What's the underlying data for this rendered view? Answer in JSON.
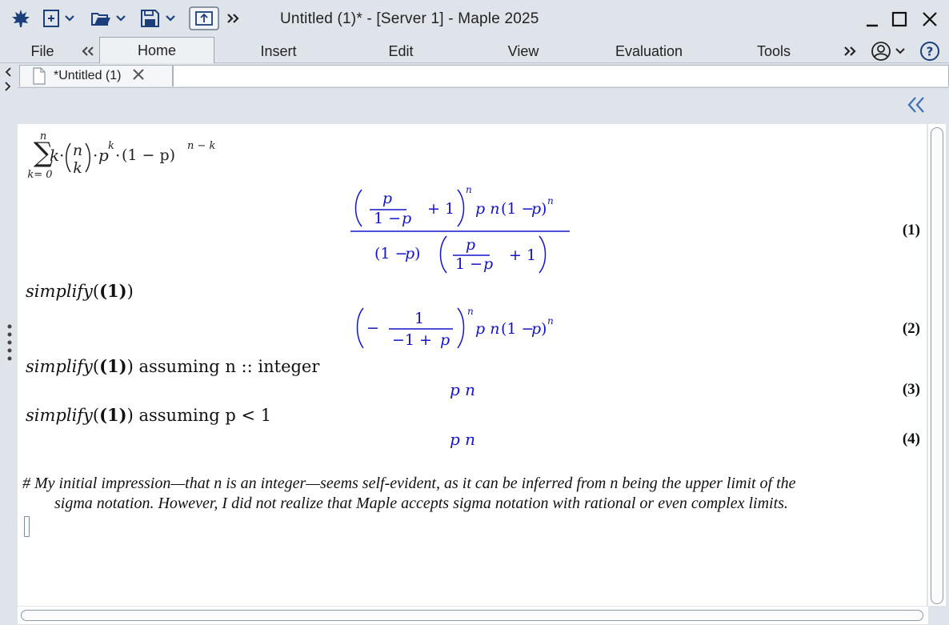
{
  "window": {
    "title": "Untitled (1)* - [Server 1] - Maple 2025"
  },
  "ribbon": {
    "tabs": [
      {
        "label": "File"
      },
      {
        "label": "Home"
      },
      {
        "label": "Insert"
      },
      {
        "label": "Edit"
      },
      {
        "label": "View"
      },
      {
        "label": "Evaluation"
      },
      {
        "label": "Tools"
      }
    ],
    "active_tab": "Home"
  },
  "document_tab": {
    "label": "*Untitled (1)"
  },
  "worksheet": {
    "input1": {
      "sum_upper": "n",
      "sum_lower": "k= 0",
      "binom_top": "n",
      "binom_bottom": "k",
      "term_k": "k",
      "p": "p",
      "exp_k": "k",
      "one_minus_p": "(1 − p)",
      "exp_nk": "n − k"
    },
    "output1": {
      "label": "(1)"
    },
    "input2": {
      "func": "simplify",
      "arg": "(1)"
    },
    "output2": {
      "label": "(2)"
    },
    "input3": {
      "func": "simplify",
      "arg": "(1)",
      "tail": " assuming n :: integer"
    },
    "output3": {
      "expr": "p n",
      "label": "(3)"
    },
    "input4": {
      "func": "simplify",
      "arg": "(1)",
      "tail": " assuming p < 1"
    },
    "output4": {
      "expr": "p n",
      "label": "(4)"
    },
    "comment": {
      "line1": "# My initial impression—that n is an integer—seems self-evident, as it can be inferred from n being the upper limit of the",
      "line2": "sigma notation. However, I did not realize that Maple accepts sigma notation with rational or even complex limits."
    }
  },
  "icons": [
    "maple-leaf-icon",
    "new-document-icon",
    "open-folder-icon",
    "save-icon",
    "export-icon",
    "chevron-right-double-icon",
    "minimize-icon",
    "maximize-icon",
    "close-icon",
    "user-icon",
    "help-icon"
  ],
  "colors": {
    "output": "#1414c8",
    "chrome": "#dfe4ea"
  }
}
